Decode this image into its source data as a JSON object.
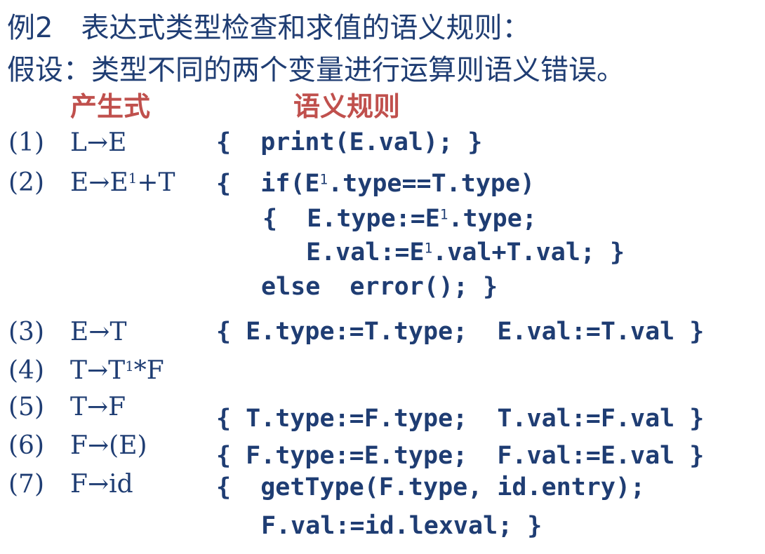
{
  "header": {
    "title": "例2　表达式类型检查和求值的语义规则：",
    "assumption": "假设：类型不同的两个变量进行运算则语义错误。"
  },
  "columns": {
    "production": "产生式",
    "semantic": "语义规则"
  },
  "rules": [
    {
      "num": "(1)",
      "prod": "L→E",
      "sem": "{  print(E.val); }"
    },
    {
      "num": "(2)",
      "prod_a": "E→E",
      "prod_sup": "1",
      "prod_b": "+T",
      "sem_line1_a": "{  if(E",
      "sem_line1_sup": "1",
      "sem_line1_b": ".type==T.type)",
      "sem_line2_a": "{  E.type:=E",
      "sem_line2_sup": "1",
      "sem_line2_b": ".type;",
      "sem_line3_a": "E.val:=E",
      "sem_line3_sup": "1",
      "sem_line3_b": ".val+T.val; }",
      "sem_line4": "else  error(); }"
    },
    {
      "num": "(3)",
      "prod": "E→T",
      "sem": "{ E.type:=T.type;  E.val:=T.val }"
    },
    {
      "num": "(4)",
      "prod_a": "T→T",
      "prod_sup": "1",
      "prod_b": "*F"
    },
    {
      "num": "(5)",
      "prod": "T→F",
      "sem": "{ T.type:=F.type;  T.val:=F.val }"
    },
    {
      "num": "(6)",
      "prod": "F→(E)",
      "sem": "{ F.type:=E.type;  F.val:=E.val }"
    },
    {
      "num": "(7)",
      "prod": "F→id",
      "sem_line1": "{  getType(F.type, id.entry);",
      "sem_line2": "F.val:=id.lexval; }"
    }
  ]
}
